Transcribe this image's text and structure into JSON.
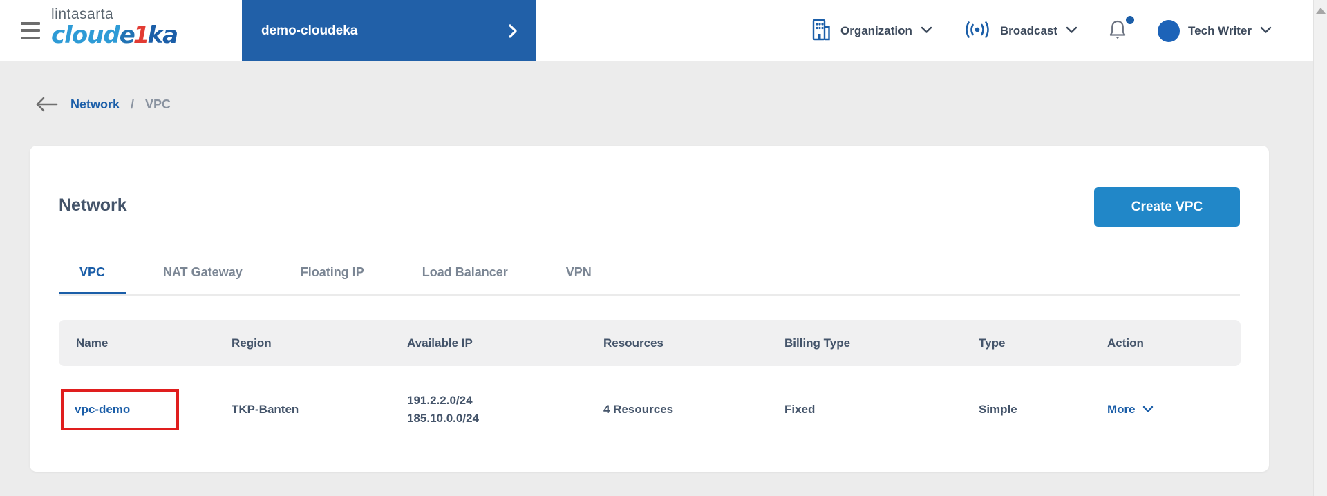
{
  "colors": {
    "accent_blue": "#1B5EA8",
    "banner_blue": "#2160A8",
    "button_blue": "#2187C8",
    "annotation_red": "#E01E1E",
    "text_dark": "#44546A",
    "text_gray": "#7B8694",
    "logo_light_blue": "#2E9BD6",
    "logo_red": "#E23B33"
  },
  "header": {
    "logo": {
      "line1": "lintasarta",
      "part_cloud": "cloud",
      "part_e": "e",
      "part_one": "1",
      "part_ka": "ka"
    },
    "project": {
      "label": "demo-cloudeka"
    },
    "organization_label": "Organization",
    "broadcast_label": "Broadcast",
    "user_label": "Tech Writer"
  },
  "breadcrumb": {
    "parent": "Network",
    "separator": "/",
    "current": "VPC"
  },
  "card": {
    "title": "Network",
    "create_button": "Create VPC",
    "tabs": [
      {
        "label": "VPC",
        "active": true
      },
      {
        "label": "NAT Gateway",
        "active": false
      },
      {
        "label": "Floating IP",
        "active": false
      },
      {
        "label": "Load Balancer",
        "active": false
      },
      {
        "label": "VPN",
        "active": false
      }
    ],
    "table": {
      "columns": [
        "Name",
        "Region",
        "Available IP",
        "Resources",
        "Billing Type",
        "Type",
        "Action"
      ],
      "rows": [
        {
          "name": "vpc-demo",
          "region": "TKP-Banten",
          "available_ip": [
            "191.2.2.0/24",
            "185.10.0.0/24"
          ],
          "resources": "4 Resources",
          "billing_type": "Fixed",
          "type": "Simple",
          "action": "More"
        }
      ]
    }
  }
}
